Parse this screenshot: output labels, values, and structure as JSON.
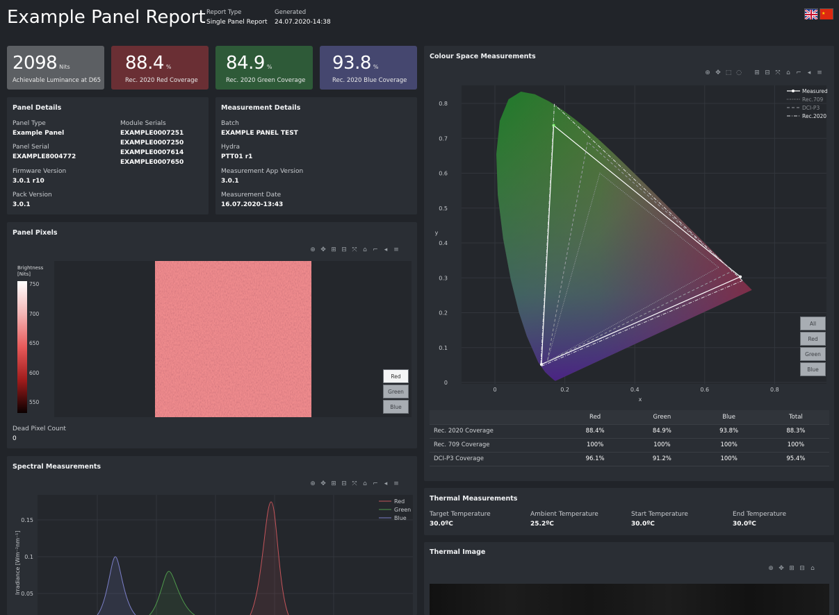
{
  "header": {
    "title": "Example Panel Report",
    "report_type_label": "Report Type",
    "report_type_value": "Single Panel Report",
    "generated_label": "Generated",
    "generated_value": "24.07.2020-14:38"
  },
  "kpis": [
    {
      "value": "2098",
      "unit": "Nits",
      "label": "Achievable Luminance at D65",
      "color": "#5c5f63"
    },
    {
      "value": "88.4",
      "unit": "%",
      "label": "Rec. 2020 Red Coverage",
      "color": "#6a2f34"
    },
    {
      "value": "84.9",
      "unit": "%",
      "label": "Rec. 2020 Green Coverage",
      "color": "#2e5a38"
    },
    {
      "value": "93.8",
      "unit": "%",
      "label": "Rec. 2020 Blue Coverage",
      "color": "#45476f"
    }
  ],
  "panel_details": {
    "title": "Panel Details",
    "panel_type_label": "Panel Type",
    "panel_type": "Example Panel",
    "panel_serial_label": "Panel Serial",
    "panel_serial": "EXAMPLE8004772",
    "firmware_label": "Firmware Version",
    "firmware": "3.0.1 r10",
    "pack_label": "Pack Version",
    "pack": "3.0.1",
    "module_serials_label": "Module Serials",
    "module_serials": [
      "EXAMPLE0007251",
      "EXAMPLE0007250",
      "EXAMPLE0007614",
      "EXAMPLE0007650"
    ]
  },
  "measurement_details": {
    "title": "Measurement Details",
    "batch_label": "Batch",
    "batch": "EXAMPLE PANEL TEST",
    "hydra_label": "Hydra",
    "hydra": "PTT01 r1",
    "app_version_label": "Measurement App Version",
    "app_version": "3.0.1",
    "date_label": "Measurement Date",
    "date": "16.07.2020-13:43"
  },
  "panel_pixels": {
    "title": "Panel Pixels",
    "colorbar_title_1": "Brightness",
    "colorbar_title_2": "[Nits]",
    "colorbar_ticks": [
      "750",
      "700",
      "650",
      "600",
      "550"
    ],
    "buttons": [
      "Red",
      "Green",
      "Blue"
    ],
    "active_button": "Red",
    "dead_pixel_label": "Dead Pixel Count",
    "dead_pixel_count": "0"
  },
  "spectral": {
    "title": "Spectral Measurements",
    "ylabel": "Irradiance [Wm⁻²nm⁻¹]",
    "y_ticks": [
      "0.15",
      "0.1",
      "0.05"
    ],
    "legend": [
      "Red",
      "Green",
      "Blue"
    ]
  },
  "colour_space": {
    "title": "Colour Space Measurements",
    "xlabel": "x",
    "ylabel": "y",
    "x_ticks": [
      "0",
      "0.2",
      "0.4",
      "0.6",
      "0.8"
    ],
    "y_ticks": [
      "0.8",
      "0.7",
      "0.6",
      "0.5",
      "0.4",
      "0.3",
      "0.2",
      "0.1",
      "0"
    ],
    "legend": [
      "Measured",
      "Rec.709",
      "DCI-P3",
      "Rec.2020"
    ],
    "buttons": [
      "All",
      "Red",
      "Green",
      "Blue"
    ]
  },
  "coverage_table": {
    "headers": [
      "",
      "Red",
      "Green",
      "Blue",
      "Total"
    ],
    "rows": [
      [
        "Rec. 2020 Coverage",
        "88.4%",
        "84.9%",
        "93.8%",
        "88.3%"
      ],
      [
        "Rec. 709 Coverage",
        "100%",
        "100%",
        "100%",
        "100%"
      ],
      [
        "DCI-P3 Coverage",
        "96.1%",
        "91.2%",
        "100%",
        "95.4%"
      ]
    ]
  },
  "thermal": {
    "title": "Thermal Measurements",
    "target_label": "Target Temperature",
    "target": "30.0ºC",
    "ambient_label": "Ambient Temperature",
    "ambient": "25.2ºC",
    "start_label": "Start Temperature",
    "start": "30.0ºC",
    "end_label": "End Temperature",
    "end": "30.0ºC"
  },
  "thermal_image": {
    "title": "Thermal Image"
  },
  "chart_data": [
    {
      "type": "scatter",
      "title": "Colour Space Measurements",
      "xlabel": "x",
      "ylabel": "y",
      "xlim": [
        -0.05,
        0.9
      ],
      "ylim": [
        0,
        0.85
      ],
      "series": [
        {
          "name": "Measured",
          "x": [
            0.702,
            0.168,
            0.133,
            0.702
          ],
          "y": [
            0.303,
            0.737,
            0.052,
            0.303
          ]
        },
        {
          "name": "Rec.709",
          "x": [
            0.64,
            0.3,
            0.15,
            0.64
          ],
          "y": [
            0.33,
            0.6,
            0.06,
            0.33
          ]
        },
        {
          "name": "DCI-P3",
          "x": [
            0.68,
            0.265,
            0.15,
            0.68
          ],
          "y": [
            0.32,
            0.69,
            0.06,
            0.32
          ]
        },
        {
          "name": "Rec.2020",
          "x": [
            0.708,
            0.17,
            0.131,
            0.708
          ],
          "y": [
            0.292,
            0.797,
            0.046,
            0.292
          ]
        }
      ],
      "legend_position": "top-right"
    },
    {
      "type": "line",
      "title": "Spectral Measurements",
      "ylabel": "Irradiance [Wm⁻²nm⁻¹]",
      "series": [
        {
          "name": "Red",
          "peak_value": 0.178
        },
        {
          "name": "Green",
          "peak_value": 0.08
        },
        {
          "name": "Blue",
          "peak_value": 0.102
        }
      ],
      "legend_position": "top-right"
    }
  ],
  "colors": {
    "background": "#212429",
    "card": "#2a2e34",
    "red_series": "#c4545a",
    "green_series": "#4f9a4c",
    "blue_series": "#7b7fc8"
  }
}
